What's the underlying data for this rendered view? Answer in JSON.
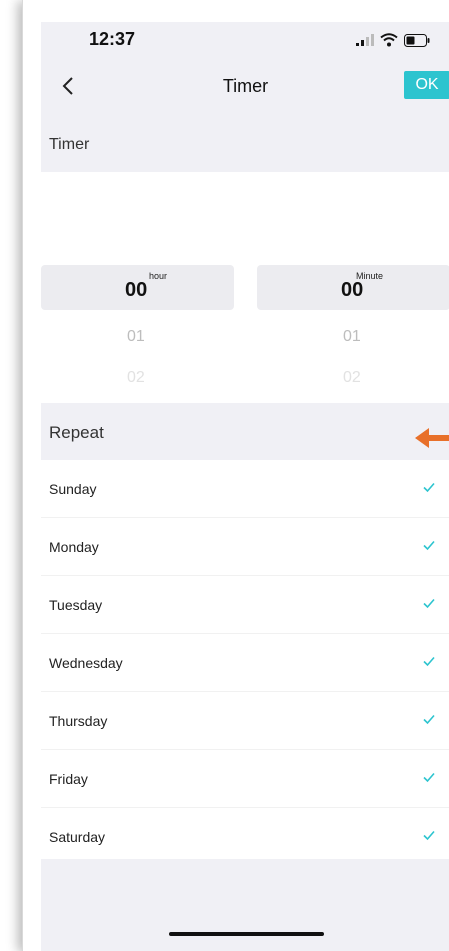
{
  "status": {
    "time": "12:37"
  },
  "nav": {
    "title": "Timer",
    "ok_label": "OK"
  },
  "timer_section": {
    "label": "Timer"
  },
  "picker": {
    "hour": {
      "value": "00",
      "label": "hour",
      "next1": "01",
      "next2": "02"
    },
    "minute": {
      "value": "00",
      "label": "Minute",
      "next1": "01",
      "next2": "02"
    }
  },
  "repeat_section": {
    "label": "Repeat"
  },
  "days": [
    {
      "label": "Sunday",
      "checked": true
    },
    {
      "label": "Monday",
      "checked": true
    },
    {
      "label": "Tuesday",
      "checked": true
    },
    {
      "label": "Wednesday",
      "checked": true
    },
    {
      "label": "Thursday",
      "checked": true
    },
    {
      "label": "Friday",
      "checked": true
    },
    {
      "label": "Saturday",
      "checked": true
    }
  ],
  "colors": {
    "accent": "#2cc4cf",
    "annotation_arrow": "#e8702a",
    "section_bg": "#f0f0f5"
  }
}
